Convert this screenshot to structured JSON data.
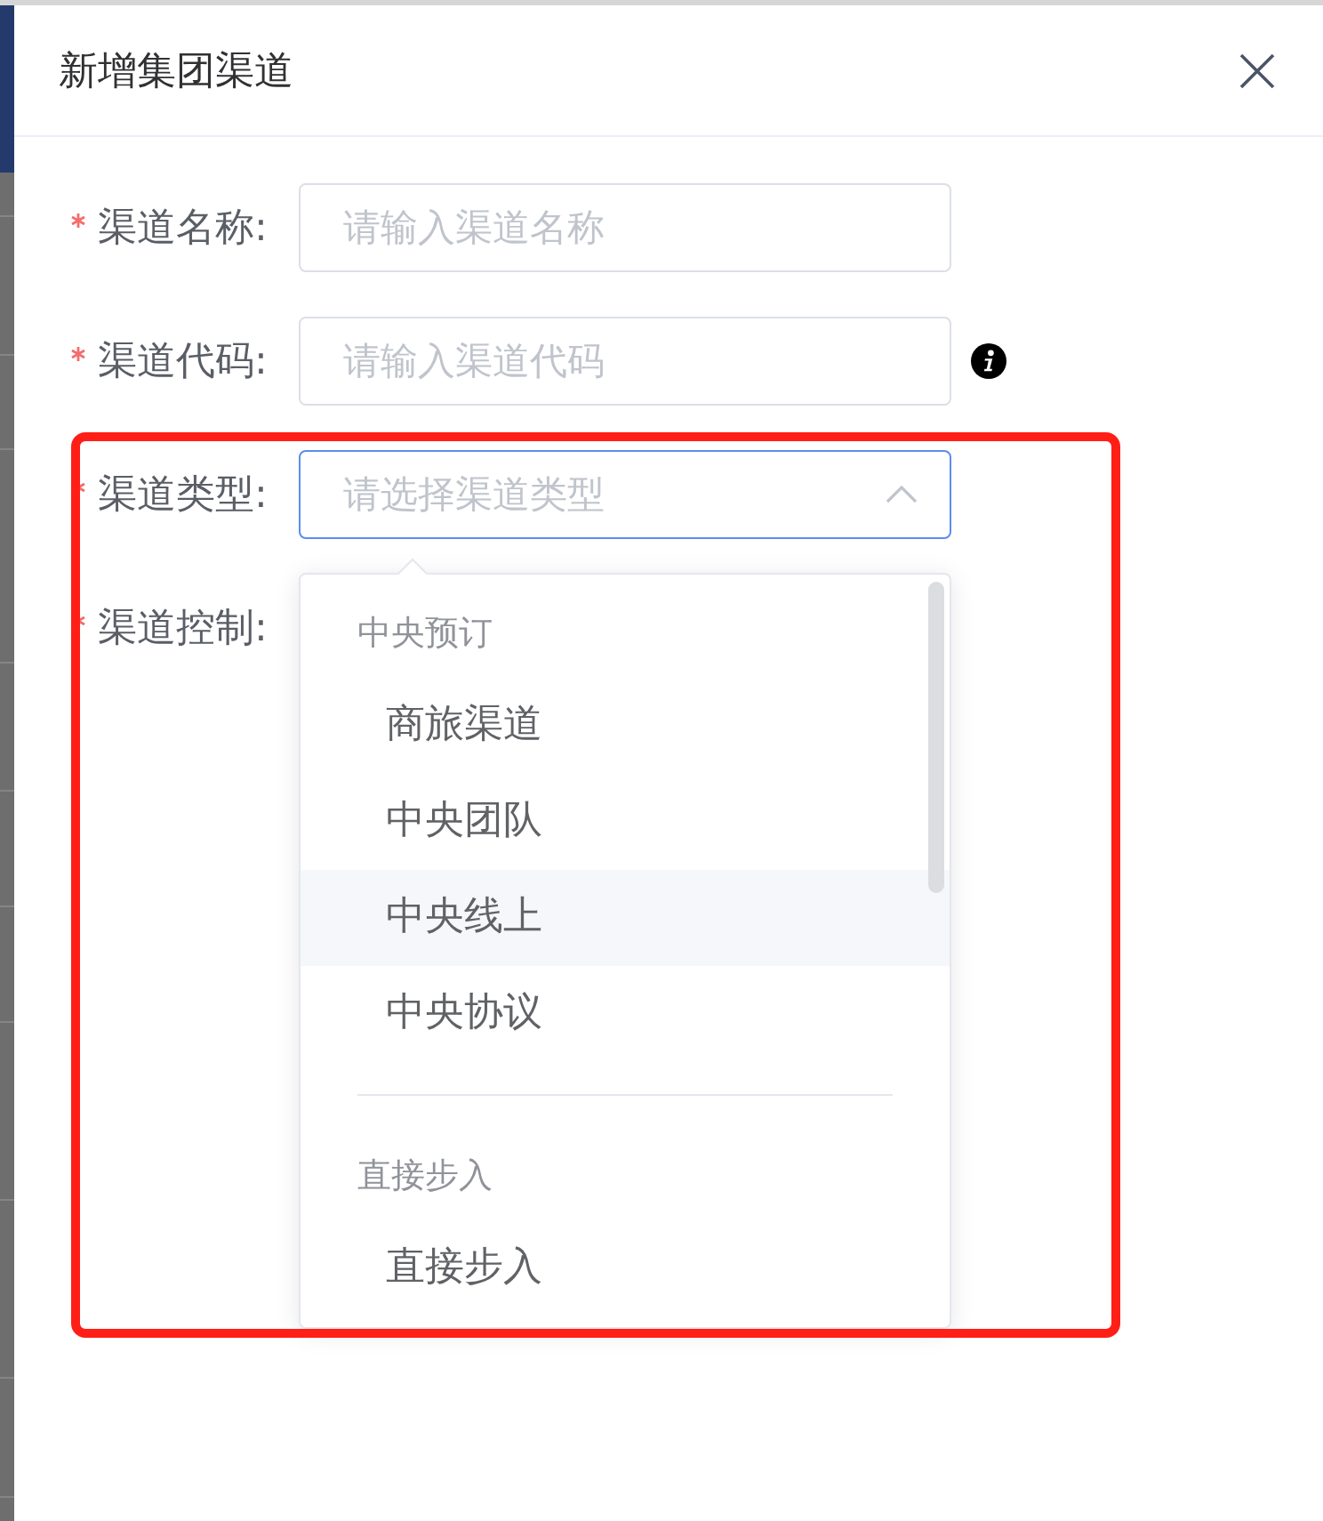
{
  "dialog": {
    "title": "新增集团渠道"
  },
  "form": {
    "fields": [
      {
        "kind": "input",
        "label": "渠道名称:",
        "required": true,
        "placeholder": "请输入渠道名称"
      },
      {
        "kind": "input",
        "label": "渠道代码:",
        "required": true,
        "placeholder": "请输入渠道代码",
        "info_icon": true
      },
      {
        "kind": "select",
        "label": "渠道类型:",
        "required": true,
        "placeholder": "请选择渠道类型",
        "expanded": true,
        "groups": [
          {
            "title": "中央预订",
            "options": [
              {
                "label": "商旅渠道",
                "highlighted": false
              },
              {
                "label": "中央团队",
                "highlighted": false
              },
              {
                "label": "中央线上",
                "highlighted": true
              },
              {
                "label": "中央协议",
                "highlighted": false
              }
            ]
          },
          {
            "title": "直接步入",
            "options": [
              {
                "label": "直接步入",
                "highlighted": false
              }
            ]
          }
        ]
      },
      {
        "kind": "covered",
        "label": "渠道控制:",
        "required": true
      }
    ]
  },
  "annotation": {
    "kind": "frame"
  }
}
